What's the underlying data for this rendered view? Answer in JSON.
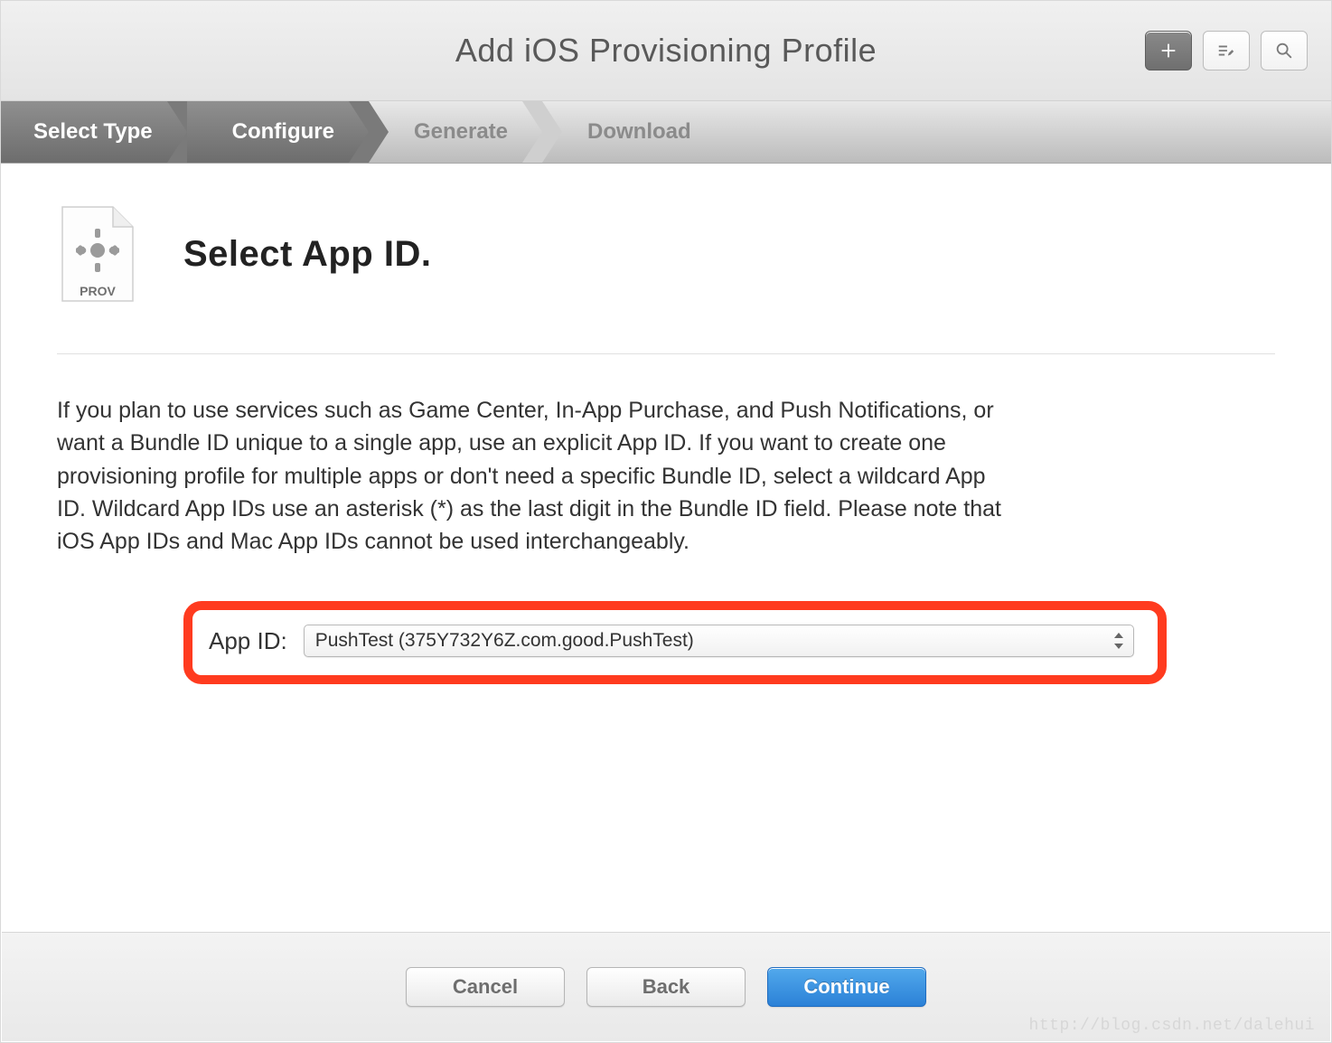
{
  "header": {
    "title": "Add iOS Provisioning Profile"
  },
  "steps": [
    "Select Type",
    "Configure",
    "Generate",
    "Download"
  ],
  "page": {
    "file_label": "PROV",
    "heading": "Select App ID.",
    "description": "If you plan to use services such as Game Center, In-App Purchase, and Push Notifications, or want a Bundle ID unique to a single app, use an explicit App ID. If you want to create one provisioning profile for multiple apps or don't need a specific Bundle ID, select a wildcard App ID. Wildcard App IDs use an asterisk (*) as the last digit in the Bundle ID field. Please note that iOS App IDs and Mac App IDs cannot be used interchangeably.",
    "appid_label": "App ID:",
    "appid_selected": "PushTest (375Y732Y6Z.com.good.PushTest)"
  },
  "footer": {
    "cancel": "Cancel",
    "back": "Back",
    "continue": "Continue"
  },
  "watermark": "http://blog.csdn.net/dalehui"
}
